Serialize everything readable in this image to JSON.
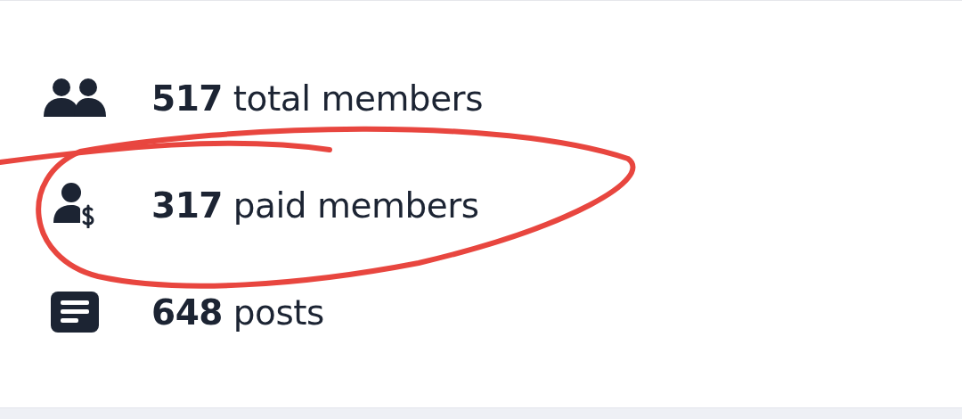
{
  "stats": [
    {
      "kind": "members",
      "text": "**517** total members"
    },
    {
      "kind": "paid",
      "text": "**317** paid members"
    },
    {
      "kind": "posts",
      "text": "**648** posts"
    }
  ],
  "annotation": {
    "kind": "circle",
    "color": "#e8463f"
  }
}
